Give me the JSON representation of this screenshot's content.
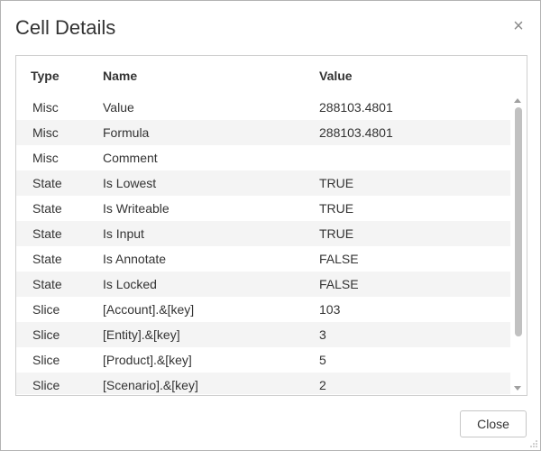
{
  "dialog": {
    "title": "Cell Details",
    "close_icon": "close-icon",
    "close_button_label": "Close"
  },
  "table": {
    "columns": [
      "Type",
      "Name",
      "Value"
    ],
    "rows": [
      {
        "type": "Misc",
        "name": "Value",
        "value": "288103.4801"
      },
      {
        "type": "Misc",
        "name": "Formula",
        "value": "288103.4801"
      },
      {
        "type": "Misc",
        "name": "Comment",
        "value": ""
      },
      {
        "type": "State",
        "name": "Is Lowest",
        "value": "TRUE"
      },
      {
        "type": "State",
        "name": "Is Writeable",
        "value": "TRUE"
      },
      {
        "type": "State",
        "name": "Is Input",
        "value": "TRUE"
      },
      {
        "type": "State",
        "name": "Is Annotate",
        "value": "FALSE"
      },
      {
        "type": "State",
        "name": "Is Locked",
        "value": "FALSE"
      },
      {
        "type": "Slice",
        "name": "[Account].&[key]",
        "value": "103"
      },
      {
        "type": "Slice",
        "name": "[Entity].&[key]",
        "value": "3"
      },
      {
        "type": "Slice",
        "name": "[Product].&[key]",
        "value": "5"
      },
      {
        "type": "Slice",
        "name": "[Scenario].&[key]",
        "value": "2"
      }
    ]
  },
  "colors": {
    "alt_row": "#f4f4f4",
    "border": "#cfcfcf",
    "scroll_thumb": "#c1c1c1"
  }
}
